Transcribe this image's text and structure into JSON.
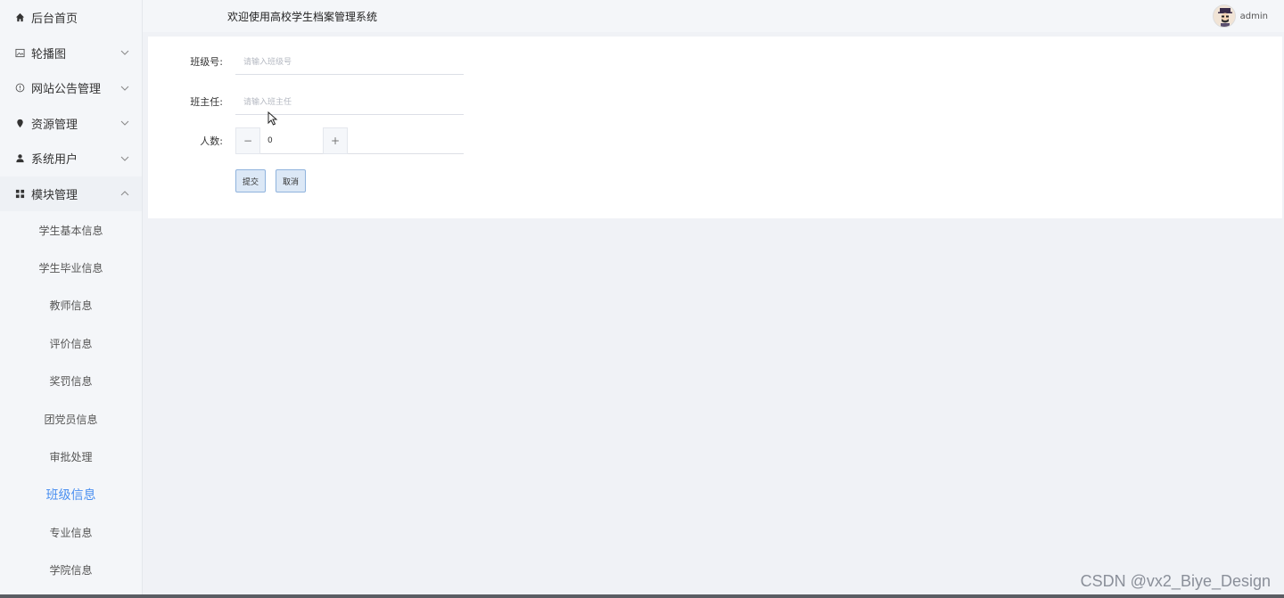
{
  "sidebar": {
    "items": [
      {
        "label": "后台首页",
        "icon": "home-icon",
        "has_chevron": false
      },
      {
        "label": "轮播图",
        "icon": "image-icon",
        "has_chevron": true
      },
      {
        "label": "网站公告管理",
        "icon": "info-icon",
        "has_chevron": true
      },
      {
        "label": "资源管理",
        "icon": "location-icon",
        "has_chevron": true
      },
      {
        "label": "系统用户",
        "icon": "user-icon",
        "has_chevron": true
      },
      {
        "label": "模块管理",
        "icon": "grid-icon",
        "has_chevron": true,
        "open": true
      }
    ],
    "submenu": [
      {
        "label": "学生基本信息"
      },
      {
        "label": "学生毕业信息"
      },
      {
        "label": "教师信息"
      },
      {
        "label": "评价信息"
      },
      {
        "label": "奖罚信息"
      },
      {
        "label": "团党员信息"
      },
      {
        "label": "审批处理"
      },
      {
        "label": "班级信息",
        "active": true
      },
      {
        "label": "专业信息"
      },
      {
        "label": "学院信息"
      }
    ]
  },
  "header": {
    "title": "欢迎使用高校学生档案管理系统",
    "username": "admin"
  },
  "form": {
    "class_no": {
      "label": "班级号:",
      "placeholder": "请输入班级号"
    },
    "head_teacher": {
      "label": "班主任:",
      "placeholder": "请输入班主任"
    },
    "count": {
      "label": "人数:",
      "value": "0",
      "minus": "−",
      "plus": "+"
    },
    "submit_label": "提交",
    "cancel_label": "取消"
  },
  "watermark": "CSDN @vx2_Biye_Design",
  "colors": {
    "accent": "#4a8ff0",
    "sidebar_bg": "#f4f6f9",
    "page_bg": "#f0f2f6",
    "button_bg": "#dce8f6"
  }
}
